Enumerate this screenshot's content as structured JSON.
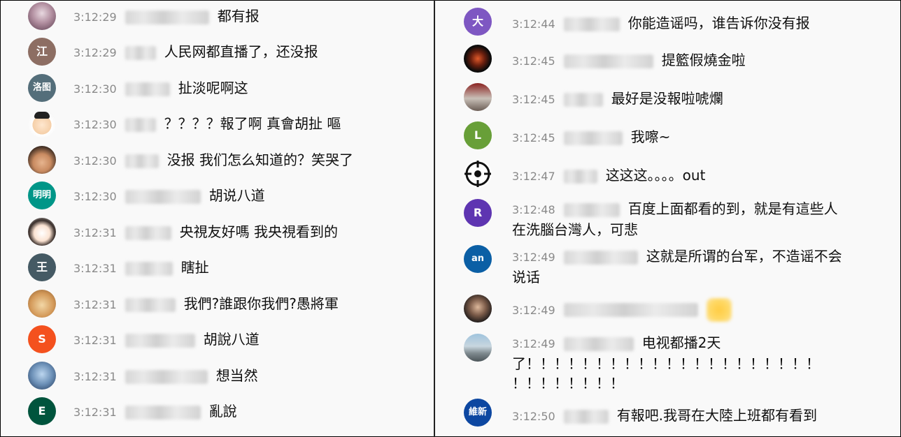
{
  "left_messages": [
    {
      "avatar": {
        "type": "image",
        "icon": "woman-portrait-avatar"
      },
      "time": "3:12:29",
      "text": "都有报"
    },
    {
      "avatar": {
        "type": "letter",
        "letter": "江",
        "color": "#8d6e63"
      },
      "time": "3:12:29",
      "text": "人民网都直播了，还没报"
    },
    {
      "avatar": {
        "type": "letter",
        "letter": "洛图",
        "color": "#546e7a"
      },
      "time": "3:12:30",
      "text": "扯淡呢啊这"
    },
    {
      "avatar": {
        "type": "image",
        "icon": "cartoon-avatar"
      },
      "time": "3:12:30",
      "text": "？？？？報了啊 真會胡扯 嘔"
    },
    {
      "avatar": {
        "type": "image",
        "icon": "boy-portrait-avatar"
      },
      "time": "3:12:30",
      "text": "没报 我们怎么知道的？笑哭了"
    },
    {
      "avatar": {
        "type": "letter",
        "letter": "明明",
        "color": "#009688"
      },
      "time": "3:12:30",
      "text": "胡说八道"
    },
    {
      "avatar": {
        "type": "image",
        "icon": "cartoon-face-avatar"
      },
      "time": "3:12:31",
      "text": "央視友好嗎 我央視看到的"
    },
    {
      "avatar": {
        "type": "letter",
        "letter": "王",
        "color": "#455a64"
      },
      "time": "3:12:31",
      "text": "瞎扯"
    },
    {
      "avatar": {
        "type": "image",
        "icon": "cat-avatar"
      },
      "time": "3:12:31",
      "text": "我們?誰跟你我們?愚將軍"
    },
    {
      "avatar": {
        "type": "letter",
        "letter": "S",
        "color": "#f4511e"
      },
      "time": "3:12:31",
      "text": "胡說八道"
    },
    {
      "avatar": {
        "type": "image",
        "icon": "blue-logo-avatar"
      },
      "time": "3:12:31",
      "text": "想当然"
    },
    {
      "avatar": {
        "type": "letter",
        "letter": "E",
        "color": "#00543d"
      },
      "time": "3:12:31",
      "text": "亂說"
    }
  ],
  "right_messages": [
    {
      "avatar": {
        "type": "letter",
        "letter": "大",
        "color": "#7e57c2"
      },
      "time": "3:12:44",
      "text": "你能造谣吗，谁告诉你没有报"
    },
    {
      "avatar": {
        "type": "image",
        "icon": "dark-logo-avatar"
      },
      "time": "3:12:45",
      "text": "提籃假燒金啦"
    },
    {
      "avatar": {
        "type": "image",
        "icon": "sign-logo-avatar"
      },
      "time": "3:12:45",
      "text": "最好是没報啦唬爛"
    },
    {
      "avatar": {
        "type": "letter",
        "letter": "L",
        "color": "#689f38"
      },
      "time": "3:12:45",
      "text": "我嚓~"
    },
    {
      "avatar": {
        "type": "icon",
        "icon": "crosshair-avatar"
      },
      "time": "3:12:47",
      "text": "这这这。。。。out"
    },
    {
      "avatar": {
        "type": "letter",
        "letter": "R",
        "color": "#5e35b1"
      },
      "time": "3:12:48",
      "text": "百度上面都看的到，就是有這些人",
      "text2": "在洗腦台灣人，可悲"
    },
    {
      "avatar": {
        "type": "letter",
        "letter": "an",
        "color": "#0b5fa5"
      },
      "time": "3:12:49",
      "text": "这就是所谓的台军，不造谣不会",
      "text2": "说话"
    },
    {
      "avatar": {
        "type": "image",
        "icon": "man-portrait-avatar"
      },
      "time": "3:12:49",
      "text": ""
    },
    {
      "avatar": {
        "type": "image",
        "icon": "city-photo-avatar"
      },
      "time": "3:12:49",
      "text": "电视都播2天",
      "text2": "了！！！！！！！！！！！！！！！！！！！！！",
      "text3": "！！！！！！！！"
    },
    {
      "avatar": {
        "type": "letter",
        "letter": "維新",
        "color": "#0d47a1"
      },
      "time": "3:12:50",
      "text": "有報吧.我哥在大陸上班都有看到"
    }
  ]
}
